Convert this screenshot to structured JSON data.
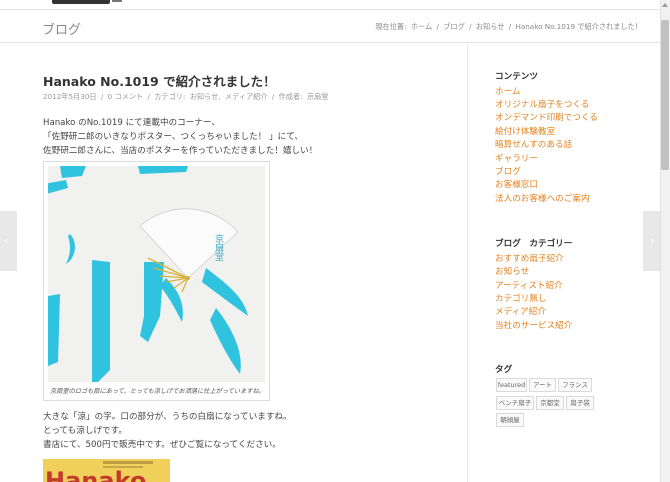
{
  "header": {
    "section_title": "ブログ",
    "breadcrumb": [
      "現在位置:",
      "ホーム",
      "/",
      "ブログ",
      "/",
      "お知らせ",
      "/",
      "Hanako No.1019 で紹介されました！"
    ]
  },
  "post": {
    "title": "Hanako No.1019 で紹介されました！",
    "meta": [
      "2012年5月30日",
      "/",
      "0 コメント",
      "/",
      "カテゴリ:",
      "お知らせ,",
      "メディア紹介",
      "/",
      "作成者:",
      "京扇堂"
    ],
    "paragraph1": [
      "Hanako のNo.1019 にて連載中のコーナー、",
      "「佐野研二郎のいきなりポスター、つくっちゃいました！ 」にて、",
      "佐野研二郎さんに、当店のポスターを作っていただきました！嬉しい！"
    ],
    "figure": {
      "poster_vertical_text": "京扇堂",
      "caption": "京扇堂のロゴも扇にあって、とっても涼しげでお洒落に仕上がっていますね。"
    },
    "paragraph2": [
      "大きな「涼」の字。口の部分が、うちの白扇になっていますね。",
      "とっても涼しげです。",
      "書店にて、500円で販売中です。ぜひご覧になってください。"
    ],
    "magazine_text": "Hanako"
  },
  "sidebar": {
    "contents_heading": "コンテンツ",
    "contents_links": [
      "ホーム",
      "オリジナル扇子をつくる",
      "オンデマンド印刷でつくる",
      "絵付け体験教室",
      "暗算せんすのある話",
      "ギャラリー",
      "ブログ",
      "お客様窓口",
      "法人のお客様へのご案内"
    ],
    "category_heading": "ブログ　カテゴリー",
    "category_links": [
      "おすすめ扇子紹介",
      "お知らせ",
      "アーティスト紹介",
      "カテゴリ無し",
      "メディア紹介",
      "当社のサービス紹介"
    ],
    "tags_heading": "タグ",
    "tags": [
      "featured",
      "アート",
      "フランス",
      "ベンチ扇子",
      "京都堂",
      "扇子袋",
      "朝顔屋"
    ]
  },
  "colors": {
    "link": "#e3821f",
    "poster_ink": "#2fc3e0",
    "fan_gold": "#d8b23a"
  }
}
